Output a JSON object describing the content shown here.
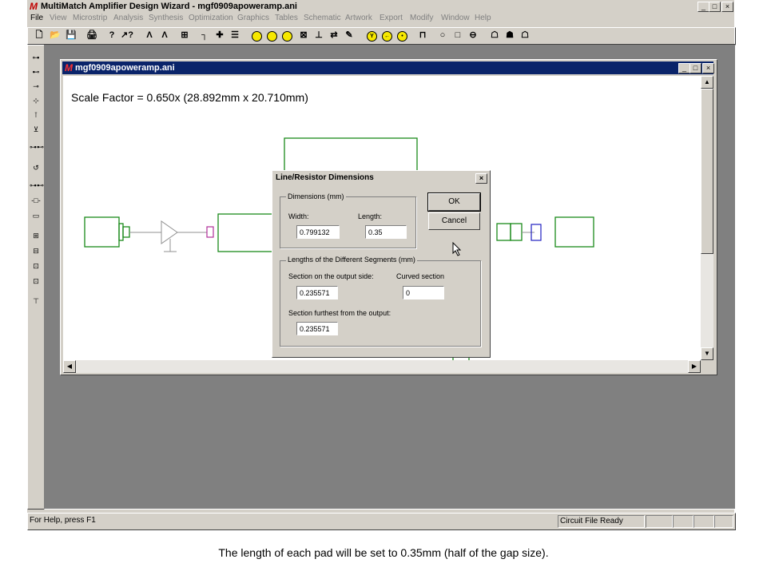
{
  "app": {
    "title": "MultiMatch Amplifier Design Wizard - mgf0909apoweramp.ani",
    "logo_letter": "M",
    "window_controls": [
      "_",
      "□",
      "×"
    ]
  },
  "menu": [
    "File",
    "View",
    "Microstrip",
    "Analysis",
    "Synthesis",
    "Optimization",
    "Graphics",
    "Tables",
    "Schematic",
    "Artwork",
    "Export",
    "Modify",
    "Window",
    "Help"
  ],
  "toolbar": {
    "icons": [
      "new-file-icon",
      "open-folder-icon",
      "save-icon",
      "print-icon",
      "help-icon",
      "context-help-icon",
      "draw-icon",
      "draw-alt-icon",
      "shape-icon",
      "line-icon",
      "cross-icon",
      "list-icon",
      "circle-icon",
      "gauge-icon",
      "target-icon",
      "box-icon",
      "tee-icon",
      "swap-icon",
      "note-icon",
      "yellow-y-icon",
      "yellow-arrow-icon",
      "yellow-dot-icon",
      "pulse-icon",
      "open-circle-icon",
      "square-icon",
      "minus-circle-icon",
      "component-a-icon",
      "component-b-icon",
      "component-c-icon"
    ],
    "glyphs": [
      "🗋",
      "📂",
      "💾",
      "🖨",
      "?",
      "↗?",
      "Λ",
      "Λ",
      "⊞",
      "┐",
      "✚",
      "☰",
      "○",
      "◔",
      "◎",
      "⊠",
      "⊥",
      "⇄",
      "✎",
      "Y",
      "←",
      "•",
      "⊓",
      "○",
      "□",
      "⊖",
      "☖",
      "☗",
      "☖"
    ]
  },
  "left_toolbar": {
    "icons": [
      "probe-a-icon",
      "probe-b-icon",
      "probe-c-icon",
      "probe-d-icon",
      "probe-e-icon",
      "probe-f-icon",
      "link-icon",
      "loop-icon",
      "link-b-icon",
      "link-c-icon",
      "rect-icon",
      "plus-box-icon",
      "minus-box-icon",
      "dot-box-icon",
      "pin-box-icon",
      "antenna-icon"
    ],
    "glyphs": [
      "⊶",
      "⊷",
      "⊸",
      "⊹",
      "⊺",
      "⊻",
      "⊶⊷",
      "↺",
      "⊶⊷",
      "-□-",
      "▭",
      "⊞",
      "⊟",
      "⊡",
      "⊡",
      "⊤"
    ]
  },
  "child_window": {
    "title": "mgf0909apoweramp.ani",
    "controls": [
      "_",
      "□",
      "×"
    ],
    "scale_text": "Scale Factor =  0.650x (28.892mm x 20.710mm)",
    "scroll_glyphs": [
      "▲",
      "▼",
      "◀",
      "▶"
    ]
  },
  "dialog": {
    "title": "Line/Resistor Dimensions",
    "close_glyph": "×",
    "dimensions_group": "Dimensions (mm)",
    "width_label": "Width:",
    "width_value": "0.799132",
    "length_label": "Length:",
    "length_value": "0.35",
    "segments_group": "Lengths of the Different Segments (mm)",
    "output_side_label": "Section on the output side:",
    "output_side_value": "0.235571",
    "curved_label": "Curved section",
    "curved_value": "0",
    "furthest_label": "Section furthest from the output:",
    "furthest_value": "0.235571",
    "ok_label": "OK",
    "cancel_label": "Cancel"
  },
  "status": {
    "help_text": "For Help, press F1",
    "state_text": "Circuit File Ready"
  },
  "caption": "The length of each pad will be set to 0.35mm (half of the gap size).",
  "colors": {
    "chrome": "#d4d0c8",
    "active_title": "#0a246a",
    "mdi_background": "#808080",
    "circuit_green": "#1a8a1a",
    "circuit_magenta": "#b0309a",
    "circuit_blue": "#2020c0"
  }
}
